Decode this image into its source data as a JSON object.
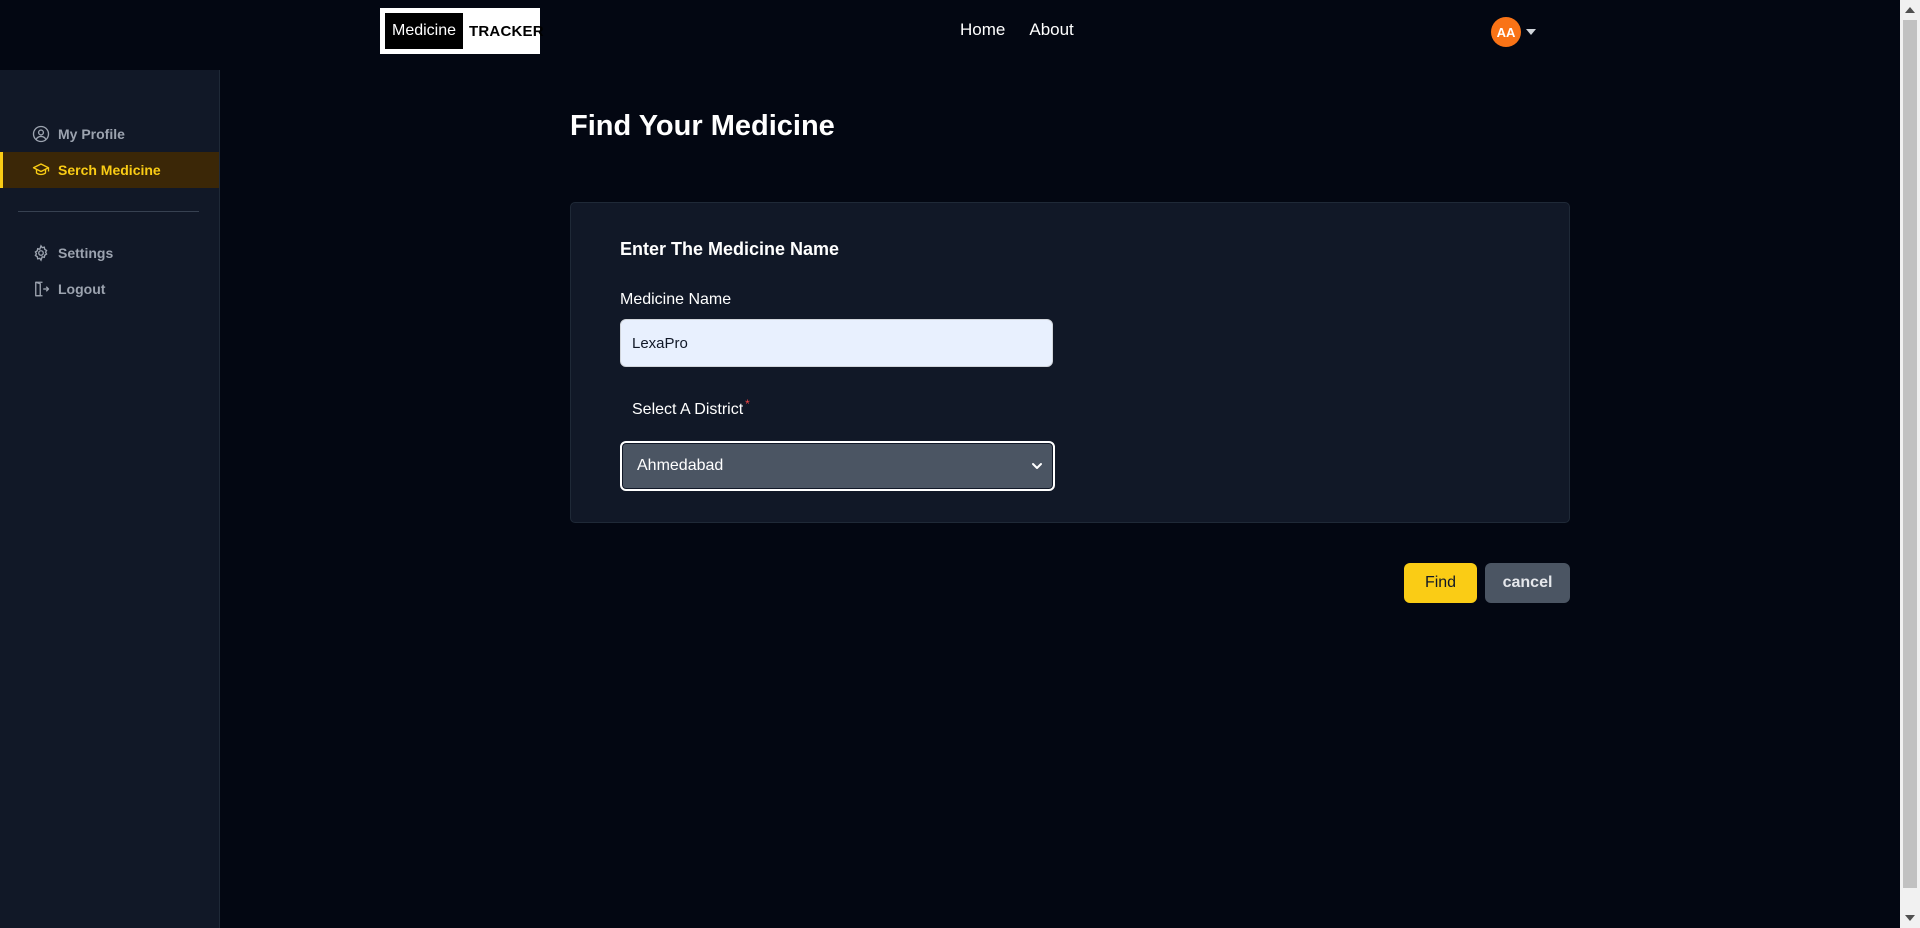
{
  "logo": {
    "part1": "Medicine",
    "part2": "TRACKER"
  },
  "nav": {
    "home": "Home",
    "about": "About"
  },
  "user": {
    "initials": "AA"
  },
  "sidebar": {
    "items": [
      {
        "label": "My Profile",
        "icon": "user-circle-icon"
      },
      {
        "label": "Serch Medicine",
        "icon": "graduation-cap-icon",
        "active": true
      },
      {
        "label": "Settings",
        "icon": "gear-icon"
      },
      {
        "label": "Logout",
        "icon": "logout-icon"
      }
    ]
  },
  "main": {
    "title": "Find Your Medicine",
    "card": {
      "heading": "Enter The Medicine Name",
      "medicine_label": "Medicine Name",
      "medicine_value": "LexaPro",
      "district_label": "Select A District",
      "required_mark": "*",
      "district_value": "Ahmedabad"
    },
    "buttons": {
      "find": "Find",
      "cancel": "cancel"
    }
  },
  "colors": {
    "background": "#030712",
    "sidebar": "#111827",
    "accent": "#facc15",
    "avatar": "#f97316"
  }
}
